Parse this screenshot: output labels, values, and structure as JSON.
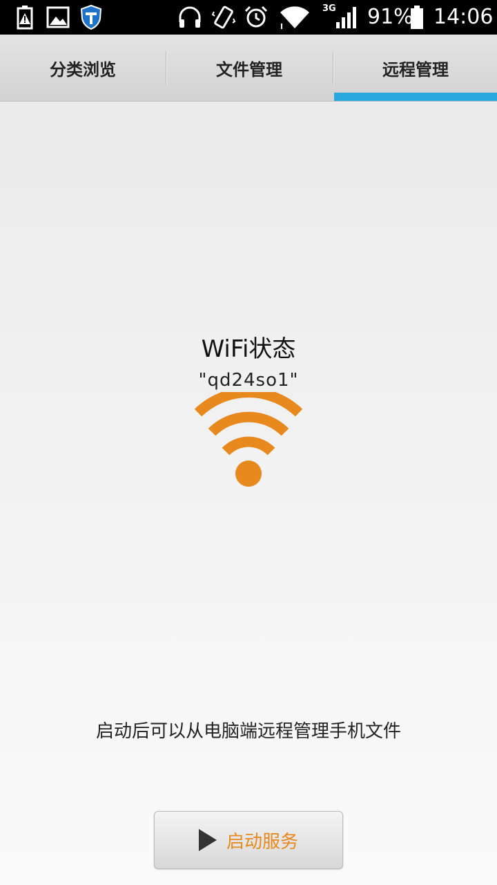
{
  "status_bar": {
    "icons": [
      "battery-alert-icon",
      "image-icon",
      "shield-icon",
      "headphones-icon",
      "vibrate-icon",
      "alarm-icon",
      "wifi-icon",
      "signal-icon",
      "battery-icon"
    ],
    "network_type": "3G",
    "battery": "91%",
    "time": "14:06"
  },
  "tabs": [
    {
      "label": "分类浏览",
      "selected": false
    },
    {
      "label": "文件管理",
      "selected": false
    },
    {
      "label": "远程管理",
      "selected": true
    }
  ],
  "main": {
    "wifi_title": "WiFi状态",
    "ssid": "\"qd24so1\"",
    "hint": "启动后可以从电脑端远程管理手机文件",
    "start_button_label": "启动服务"
  },
  "colors": {
    "accent": "#29a8e0",
    "wifi_orange": "#e8891e",
    "button_text": "#e8891e"
  }
}
